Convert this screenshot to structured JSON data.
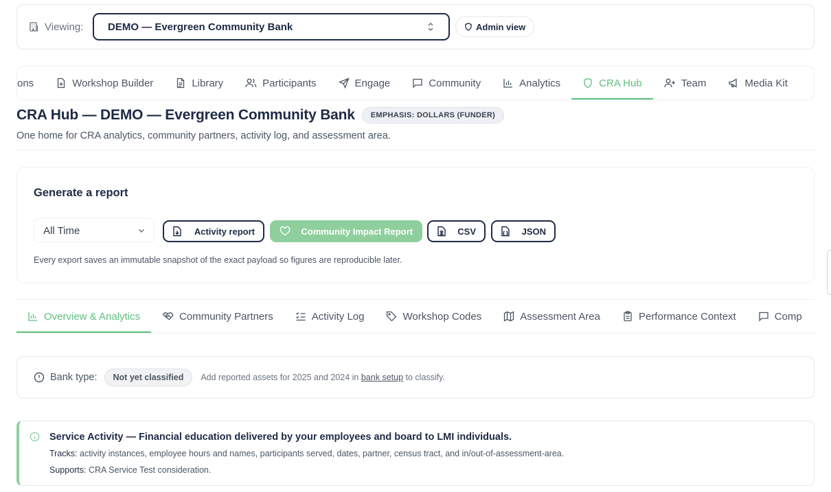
{
  "viewing": {
    "label": "Viewing:",
    "bank": "DEMO — Evergreen Community Bank",
    "admin_label": "Admin view"
  },
  "main_tabs": [
    {
      "label": "ons",
      "icon": "none",
      "active": false
    },
    {
      "label": "Workshop Builder",
      "icon": "file-plus-icon",
      "active": false
    },
    {
      "label": "Library",
      "icon": "file-text-icon",
      "active": false
    },
    {
      "label": "Participants",
      "icon": "users-icon",
      "active": false
    },
    {
      "label": "Engage",
      "icon": "send-icon",
      "active": false
    },
    {
      "label": "Community",
      "icon": "message-square-icon",
      "active": false
    },
    {
      "label": "Analytics",
      "icon": "bar-chart-icon",
      "active": false
    },
    {
      "label": "CRA Hub",
      "icon": "shield-icon",
      "active": true
    },
    {
      "label": "Team",
      "icon": "user-plus-icon",
      "active": false
    },
    {
      "label": "Media Kit",
      "icon": "megaphone-icon",
      "active": false
    }
  ],
  "page": {
    "title": "CRA Hub — DEMO — Evergreen Community Bank",
    "emphasis": "EMPHASIS: DOLLARS (FUNDER)",
    "subtitle": "One home for CRA analytics, community partners, activity log, and assessment area."
  },
  "report": {
    "title": "Generate a report",
    "period": "All Time",
    "buttons": {
      "activity": "Activity report",
      "impact": "Community Impact Report",
      "csv": "CSV",
      "json": "JSON"
    },
    "note": "Every export saves an immutable snapshot of the exact payload so figures are reproducible later."
  },
  "sub_tabs": [
    {
      "label": "Overview & Analytics",
      "icon": "bar-chart-icon",
      "active": true
    },
    {
      "label": "Community Partners",
      "icon": "handshake-icon",
      "active": false
    },
    {
      "label": "Activity Log",
      "icon": "list-checks-icon",
      "active": false
    },
    {
      "label": "Workshop Codes",
      "icon": "tag-icon",
      "active": false
    },
    {
      "label": "Assessment Area",
      "icon": "map-icon",
      "active": false
    },
    {
      "label": "Performance Context",
      "icon": "clipboard-icon",
      "active": false
    },
    {
      "label": "Comp",
      "icon": "message-square-icon",
      "active": false
    }
  ],
  "bank_type": {
    "label": "Bank type:",
    "status": "Not yet classified",
    "note_prefix": "Add reported assets for 2025 and 2024 in",
    "link": "bank setup",
    "note_suffix": "to classify."
  },
  "service": {
    "title": "Service Activity — Financial education delivered by your employees and board to LMI individuals.",
    "tracks_label": "Tracks:",
    "tracks": "activity instances, employee hours and names, participants served, dates, partner, census tract, and in/out-of-assessment-area.",
    "supports_label": "Supports:",
    "supports": "CRA Service Test consideration."
  },
  "colors": {
    "navy": "#1e2a44",
    "accent": "#5fbf7f",
    "accent_light": "#8fcf9d"
  }
}
